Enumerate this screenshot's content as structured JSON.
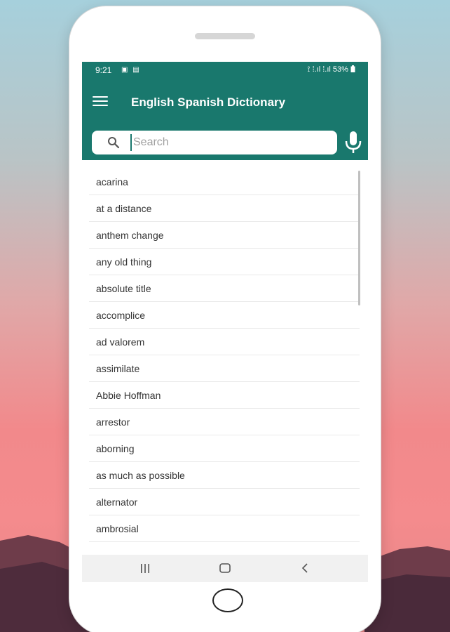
{
  "status_bar": {
    "time": "9:21",
    "left_icons": "▣ ▤",
    "right": "⟟ ⁞.ıl ⁞.ıl 53%",
    "battery_icon": "battery-icon"
  },
  "app_bar": {
    "title": "English Spanish Dictionary",
    "menu_icon": "menu-icon"
  },
  "search": {
    "placeholder": "Search",
    "value": "",
    "search_icon": "search-icon",
    "mic_icon": "microphone-icon"
  },
  "words": [
    "acarina",
    "at a distance",
    "anthem change",
    "any old thing",
    "absolute title",
    "accomplice",
    "ad valorem",
    "assimilate",
    "Abbie Hoffman",
    "arrestor",
    "aborning",
    "as much as possible",
    "alternator",
    "ambrosial"
  ],
  "nav_bar": {
    "recent_icon": "recent-apps-icon",
    "home_icon": "home-icon",
    "back_icon": "back-icon"
  },
  "colors": {
    "app_bar": "#19786d",
    "background_top": "#a6d0dc",
    "background_bottom": "#f48b8d"
  }
}
